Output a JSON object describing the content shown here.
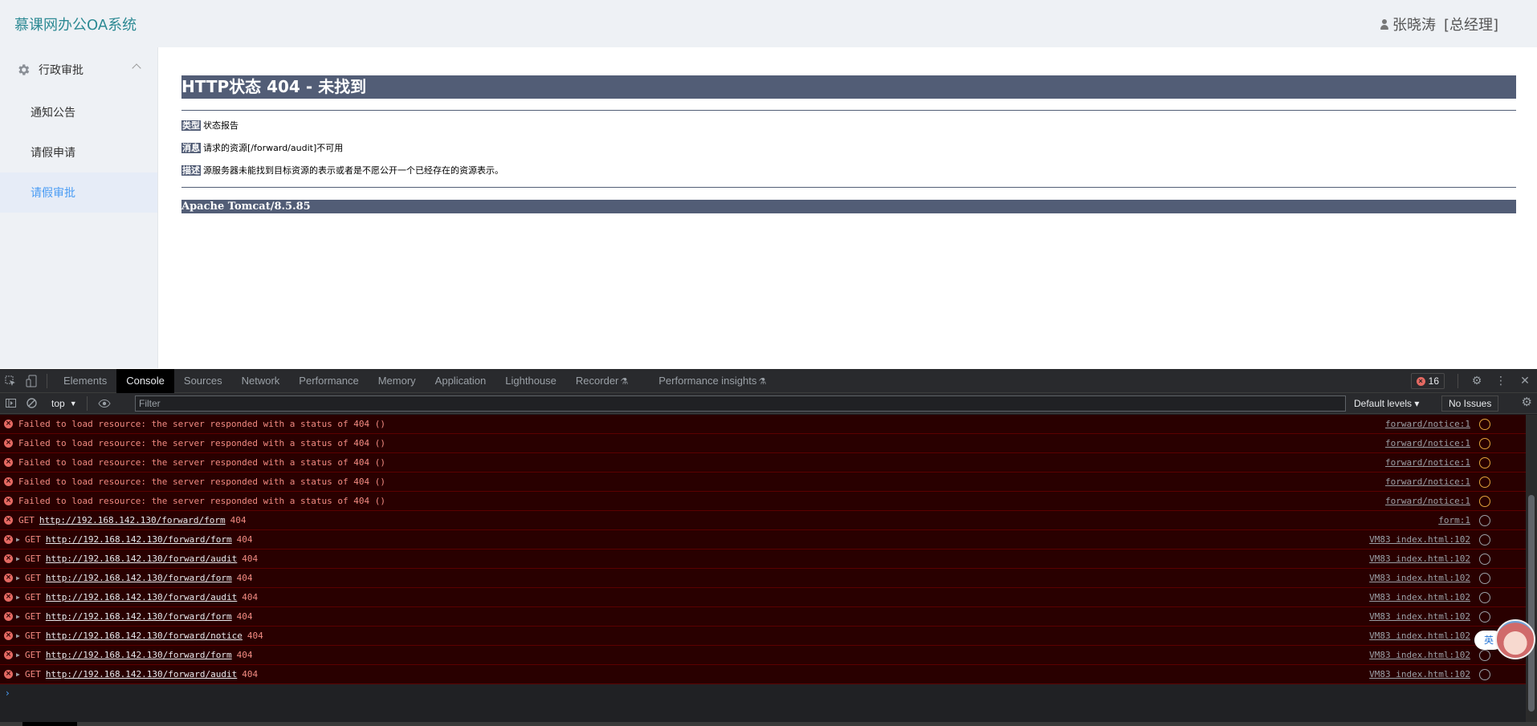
{
  "app": {
    "title": "慕课网办公OA系统",
    "user_name": "张晓涛",
    "user_role": "[总经理]"
  },
  "sidebar": {
    "group_label": "行政审批",
    "items": [
      {
        "label": "通知公告",
        "active": false
      },
      {
        "label": "请假申请",
        "active": false
      },
      {
        "label": "请假审批",
        "active": true
      }
    ]
  },
  "error_page": {
    "heading": "HTTP状态 404 - 未找到",
    "type_tag": "类型",
    "type_text": "状态报告",
    "message_tag": "消息",
    "message_text": "请求的资源[/forward/audit]不可用",
    "desc_tag": "描述",
    "desc_text": "源服务器未能找到目标资源的表示或者是不愿公开一个已经存在的资源表示。",
    "footer": "Apache Tomcat/8.5.85"
  },
  "devtools": {
    "tabs": [
      {
        "label": "Elements",
        "active": false
      },
      {
        "label": "Console",
        "active": true
      },
      {
        "label": "Sources",
        "active": false
      },
      {
        "label": "Network",
        "active": false
      },
      {
        "label": "Performance",
        "active": false
      },
      {
        "label": "Memory",
        "active": false
      },
      {
        "label": "Application",
        "active": false
      },
      {
        "label": "Lighthouse",
        "active": false
      },
      {
        "label": "Recorder",
        "active": false,
        "flask": true
      },
      {
        "label": "Performance insights",
        "active": false,
        "flask": true
      }
    ],
    "error_count": "16",
    "context": "top",
    "filter_placeholder": "Filter",
    "levels_label": "Default levels ▾",
    "issues_label": "No Issues",
    "logs": [
      {
        "expandable": false,
        "prefix": "Failed to load resource: the server responded with a status of 404 ()",
        "url": "",
        "suffix": "",
        "source": "forward/notice:1",
        "icon": "warn"
      },
      {
        "expandable": false,
        "prefix": "Failed to load resource: the server responded with a status of 404 ()",
        "url": "",
        "suffix": "",
        "source": "forward/notice:1",
        "icon": "warn"
      },
      {
        "expandable": false,
        "prefix": "Failed to load resource: the server responded with a status of 404 ()",
        "url": "",
        "suffix": "",
        "source": "forward/notice:1",
        "icon": "warn"
      },
      {
        "expandable": false,
        "prefix": "Failed to load resource: the server responded with a status of 404 ()",
        "url": "",
        "suffix": "",
        "source": "forward/notice:1",
        "icon": "warn"
      },
      {
        "expandable": false,
        "prefix": "Failed to load resource: the server responded with a status of 404 ()",
        "url": "",
        "suffix": "",
        "source": "forward/notice:1",
        "icon": "warn"
      },
      {
        "expandable": false,
        "prefix": "GET",
        "url": "http://192.168.142.130/forward/form",
        "suffix": "404",
        "source": "form:1",
        "icon": "net"
      },
      {
        "expandable": true,
        "prefix": "GET",
        "url": "http://192.168.142.130/forward/form",
        "suffix": "404",
        "source": "VM83 index.html:102",
        "icon": "net"
      },
      {
        "expandable": true,
        "prefix": "GET",
        "url": "http://192.168.142.130/forward/audit",
        "suffix": "404",
        "source": "VM83 index.html:102",
        "icon": "net"
      },
      {
        "expandable": true,
        "prefix": "GET",
        "url": "http://192.168.142.130/forward/form",
        "suffix": "404",
        "source": "VM83 index.html:102",
        "icon": "net"
      },
      {
        "expandable": true,
        "prefix": "GET",
        "url": "http://192.168.142.130/forward/audit",
        "suffix": "404",
        "source": "VM83 index.html:102",
        "icon": "net"
      },
      {
        "expandable": true,
        "prefix": "GET",
        "url": "http://192.168.142.130/forward/form",
        "suffix": "404",
        "source": "VM83 index.html:102",
        "icon": "net"
      },
      {
        "expandable": true,
        "prefix": "GET",
        "url": "http://192.168.142.130/forward/notice",
        "suffix": "404",
        "source": "VM83 index.html:102",
        "icon": "net"
      },
      {
        "expandable": true,
        "prefix": "GET",
        "url": "http://192.168.142.130/forward/form",
        "suffix": "404",
        "source": "VM83 index.html:102",
        "icon": "net"
      },
      {
        "expandable": true,
        "prefix": "GET",
        "url": "http://192.168.142.130/forward/audit",
        "suffix": "404",
        "source": "VM83 index.html:102",
        "icon": "net"
      }
    ]
  },
  "float_widget": {
    "label": "英"
  },
  "colors": {
    "brand": "#2d8a94",
    "active_menu": "#4a9cf4",
    "tomcat_bar": "#525d76",
    "console_error_bg": "#290000",
    "console_error_text": "#f28b82"
  }
}
